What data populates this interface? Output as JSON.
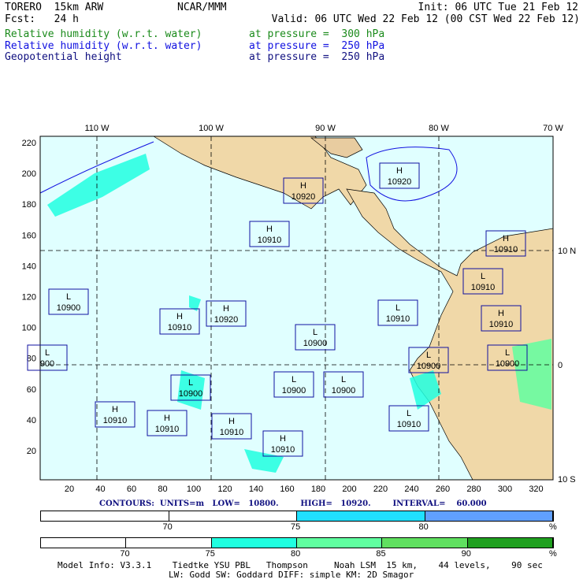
{
  "header": {
    "model": "TORERO  15km ARW",
    "org": "NCAR/MMM",
    "init": "Init: 06 UTC Tue 21 Feb 12",
    "fcst": "Fcst:   24 h",
    "valid": "Valid: 06 UTC Wed 22 Feb 12 (00 CST Wed 22 Feb 12)"
  },
  "fields": [
    {
      "name": "Relative humidity (w.r.t. water)",
      "level": "at pressure =  300 hPa",
      "color": "#1a8a1a"
    },
    {
      "name": "Relative humidity (w.r.t. water)",
      "level": "at pressure =  250 hPa",
      "color": "#1010e0"
    },
    {
      "name": "Geopotential height",
      "level": "at pressure =  250 hPa",
      "color": "#101080"
    }
  ],
  "map": {
    "lon_labels": [
      "110 W",
      "100 W",
      "90 W",
      "80 W",
      "70 W"
    ],
    "lat_labels": [
      "10 N",
      "0",
      "10 S"
    ],
    "y_ticks": [
      "220",
      "200",
      "180",
      "160",
      "140",
      "120",
      "100",
      "80",
      "60",
      "40",
      "20"
    ],
    "x_ticks": [
      "20",
      "40",
      "60",
      "80",
      "100",
      "120",
      "140",
      "160",
      "180",
      "200",
      "220",
      "240",
      "260",
      "280",
      "300",
      "320"
    ],
    "centers": [
      {
        "type": "H",
        "value": "10920"
      },
      {
        "type": "H",
        "value": "10920"
      },
      {
        "type": "H",
        "value": "10910"
      },
      {
        "type": "H",
        "value": "10910"
      },
      {
        "type": "L",
        "value": "10910"
      },
      {
        "type": "L",
        "value": "10900"
      },
      {
        "type": "H",
        "value": "10920"
      },
      {
        "type": "H",
        "value": "10910"
      },
      {
        "type": "L",
        "value": "10910"
      },
      {
        "type": "H",
        "value": "10910"
      },
      {
        "type": "L",
        "value": "10900"
      },
      {
        "type": "L",
        "value": "900"
      },
      {
        "type": "L",
        "value": "10900"
      },
      {
        "type": "L",
        "value": "10900"
      },
      {
        "type": "L",
        "value": "10900"
      },
      {
        "type": "L",
        "value": "10900"
      },
      {
        "type": "L",
        "value": "10900"
      },
      {
        "type": "H",
        "value": "10910"
      },
      {
        "type": "H",
        "value": "10910"
      },
      {
        "type": "H",
        "value": "10910"
      },
      {
        "type": "L",
        "value": "10910"
      },
      {
        "type": "H",
        "value": "10910"
      }
    ]
  },
  "contours": "CONTOURS:  UNITS=m   LOW=   10800.        HIGH=   10920.        INTERVAL=    60.000",
  "legend1": {
    "labels": [
      "70",
      "75",
      "80"
    ],
    "unit": "%",
    "colors": [
      "#ffffff",
      "#ffffff",
      "#20e0ff",
      "#60a0ff"
    ]
  },
  "legend2": {
    "labels": [
      "70",
      "75",
      "80",
      "85",
      "90"
    ],
    "unit": "%",
    "colors": [
      "#ffffff",
      "#ffffff",
      "#20ffe0",
      "#60ffa0",
      "#60e060",
      "#20a020"
    ]
  },
  "model_info": [
    "Model Info: V3.3.1    Tiedtke YSU PBL   Thompson     Noah LSM  15 km,    44 levels,    90 sec",
    "LW: Godd SW: Goddard DIFF: simple KM: 2D Smagor"
  ]
}
